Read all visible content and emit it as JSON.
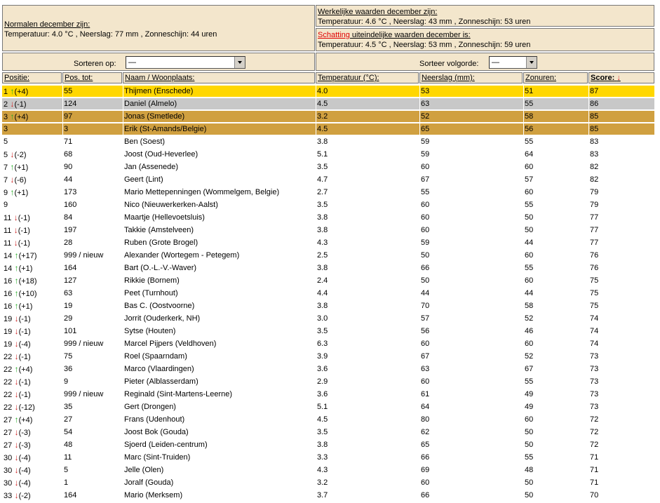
{
  "normals": {
    "heading": "Normalen december zijn:",
    "text": "Temperatuur: 4.0 °C , Neerslag: 77 mm , Zonneschijn: 44 uren"
  },
  "actual": {
    "heading": "Werkelijke waarden december zijn:",
    "text": "Temperatuur: 4.6 °C , Neerslag: 43 mm , Zonneschijn: 53 uren"
  },
  "estimate": {
    "heading_red": "Schatting",
    "heading_rest": " uiteindelijke waarden december is:",
    "text": "Temperatuur: 4.5 °C , Neerslag: 53 mm , Zonneschijn: 59 uren"
  },
  "sort": {
    "label": "Sorteren op:",
    "value": "—",
    "order_label": "Sorteer volgorde:",
    "order_value": "—"
  },
  "columns": {
    "pos": "Positie:",
    "postot": "Pos. tot:",
    "name": "Naam / Woonplaats:",
    "temp": "Temperatuur (°C):",
    "rain": "Neerslag (mm):",
    "sun": "Zonuren:",
    "score": "Score:"
  },
  "colors": {
    "gold": "#ffd700",
    "silver": "#c8c8c8",
    "bronze": "#d0a040",
    "header_bg": "#f3e6cc",
    "up_arrow": "#22aa22",
    "down_arrow": "#cc2222"
  },
  "rows": [
    {
      "pos": "1",
      "dir": "up",
      "chg": "(+4)",
      "tot": "55",
      "name": "Thijmen (Enschede)",
      "temp": "4.0",
      "rain": "53",
      "sun": "51",
      "score": "87",
      "hl": "gold"
    },
    {
      "pos": "2",
      "dir": "down",
      "chg": "(-1)",
      "tot": "124",
      "name": "Daniel (Almelo)",
      "temp": "4.5",
      "rain": "63",
      "sun": "55",
      "score": "86",
      "hl": "silver"
    },
    {
      "pos": "3",
      "dir": "up",
      "chg": "(+4)",
      "tot": "97",
      "name": "Jonas (Smetlede)",
      "temp": "3.2",
      "rain": "52",
      "sun": "58",
      "score": "85",
      "hl": "bronze"
    },
    {
      "pos": "3",
      "dir": "",
      "chg": "",
      "tot": "3",
      "name": "Erik (St-Amands/Belgie)",
      "temp": "4.5",
      "rain": "65",
      "sun": "56",
      "score": "85",
      "hl": "bronze"
    },
    {
      "pos": "5",
      "dir": "",
      "chg": "",
      "tot": "71",
      "name": "Ben (Soest)",
      "temp": "3.8",
      "rain": "59",
      "sun": "55",
      "score": "83",
      "hl": ""
    },
    {
      "pos": "5",
      "dir": "down",
      "chg": "(-2)",
      "tot": "68",
      "name": "Joost (Oud-Heverlee)",
      "temp": "5.1",
      "rain": "59",
      "sun": "64",
      "score": "83",
      "hl": ""
    },
    {
      "pos": "7",
      "dir": "up",
      "chg": "(+1)",
      "tot": "90",
      "name": "Jan (Assenede)",
      "temp": "3.5",
      "rain": "60",
      "sun": "60",
      "score": "82",
      "hl": ""
    },
    {
      "pos": "7",
      "dir": "down",
      "chg": "(-6)",
      "tot": "44",
      "name": "Geert (Lint)",
      "temp": "4.7",
      "rain": "67",
      "sun": "57",
      "score": "82",
      "hl": ""
    },
    {
      "pos": "9",
      "dir": "up",
      "chg": "(+1)",
      "tot": "173",
      "name": "Mario Mettepenningen (Wommelgem, Belgie)",
      "temp": "2.7",
      "rain": "55",
      "sun": "60",
      "score": "79",
      "hl": ""
    },
    {
      "pos": "9",
      "dir": "",
      "chg": "",
      "tot": "160",
      "name": "Nico (Nieuwerkerken-Aalst)",
      "temp": "3.5",
      "rain": "60",
      "sun": "55",
      "score": "79",
      "hl": ""
    },
    {
      "pos": "11",
      "dir": "down",
      "chg": "(-1)",
      "tot": "84",
      "name": "Maartje (Hellevoetsluis)",
      "temp": "3.8",
      "rain": "60",
      "sun": "50",
      "score": "77",
      "hl": ""
    },
    {
      "pos": "11",
      "dir": "down",
      "chg": "(-1)",
      "tot": "197",
      "name": "Takkie (Amstelveen)",
      "temp": "3.8",
      "rain": "60",
      "sun": "50",
      "score": "77",
      "hl": ""
    },
    {
      "pos": "11",
      "dir": "down",
      "chg": "(-1)",
      "tot": "28",
      "name": "Ruben (Grote Brogel)",
      "temp": "4.3",
      "rain": "59",
      "sun": "44",
      "score": "77",
      "hl": ""
    },
    {
      "pos": "14",
      "dir": "up",
      "chg": "(+17)",
      "tot": "999 / nieuw",
      "name": "Alexander (Wortegem - Petegem)",
      "temp": "2.5",
      "rain": "50",
      "sun": "60",
      "score": "76",
      "hl": ""
    },
    {
      "pos": "14",
      "dir": "up",
      "chg": "(+1)",
      "tot": "164",
      "name": "Bart (O.-L.-V.-Waver)",
      "temp": "3.8",
      "rain": "66",
      "sun": "55",
      "score": "76",
      "hl": ""
    },
    {
      "pos": "16",
      "dir": "up",
      "chg": "(+18)",
      "tot": "127",
      "name": "Rikkie (Bornem)",
      "temp": "2.4",
      "rain": "50",
      "sun": "60",
      "score": "75",
      "hl": ""
    },
    {
      "pos": "16",
      "dir": "up",
      "chg": "(+10)",
      "tot": "63",
      "name": "Peet (Turnhout)",
      "temp": "4.4",
      "rain": "44",
      "sun": "44",
      "score": "75",
      "hl": ""
    },
    {
      "pos": "16",
      "dir": "up",
      "chg": "(+1)",
      "tot": "19",
      "name": "Bas C. (Oostvoorne)",
      "temp": "3.8",
      "rain": "70",
      "sun": "58",
      "score": "75",
      "hl": ""
    },
    {
      "pos": "19",
      "dir": "down",
      "chg": "(-1)",
      "tot": "29",
      "name": "Jorrit (Ouderkerk, NH)",
      "temp": "3.0",
      "rain": "57",
      "sun": "52",
      "score": "74",
      "hl": ""
    },
    {
      "pos": "19",
      "dir": "down",
      "chg": "(-1)",
      "tot": "101",
      "name": "Sytse (Houten)",
      "temp": "3.5",
      "rain": "56",
      "sun": "46",
      "score": "74",
      "hl": ""
    },
    {
      "pos": "19",
      "dir": "down",
      "chg": "(-4)",
      "tot": "999 / nieuw",
      "name": "Marcel Pijpers (Veldhoven)",
      "temp": "6.3",
      "rain": "60",
      "sun": "60",
      "score": "74",
      "hl": ""
    },
    {
      "pos": "22",
      "dir": "down",
      "chg": "(-1)",
      "tot": "75",
      "name": "Roel (Spaarndam)",
      "temp": "3.9",
      "rain": "67",
      "sun": "52",
      "score": "73",
      "hl": ""
    },
    {
      "pos": "22",
      "dir": "up",
      "chg": "(+4)",
      "tot": "36",
      "name": "Marco (Vlaardingen)",
      "temp": "3.6",
      "rain": "63",
      "sun": "67",
      "score": "73",
      "hl": ""
    },
    {
      "pos": "22",
      "dir": "down",
      "chg": "(-1)",
      "tot": "9",
      "name": "Pieter (Alblasserdam)",
      "temp": "2.9",
      "rain": "60",
      "sun": "55",
      "score": "73",
      "hl": ""
    },
    {
      "pos": "22",
      "dir": "down",
      "chg": "(-1)",
      "tot": "999 / nieuw",
      "name": "Reginald (Sint-Martens-Leerne)",
      "temp": "3.6",
      "rain": "61",
      "sun": "49",
      "score": "73",
      "hl": ""
    },
    {
      "pos": "22",
      "dir": "down",
      "chg": "(-12)",
      "tot": "35",
      "name": "Gert (Drongen)",
      "temp": "5.1",
      "rain": "64",
      "sun": "49",
      "score": "73",
      "hl": ""
    },
    {
      "pos": "27",
      "dir": "up",
      "chg": "(+4)",
      "tot": "27",
      "name": "Frans (Udenhout)",
      "temp": "4.5",
      "rain": "80",
      "sun": "60",
      "score": "72",
      "hl": ""
    },
    {
      "pos": "27",
      "dir": "down",
      "chg": "(-3)",
      "tot": "54",
      "name": "Joost Bok (Gouda)",
      "temp": "3.5",
      "rain": "62",
      "sun": "50",
      "score": "72",
      "hl": ""
    },
    {
      "pos": "27",
      "dir": "down",
      "chg": "(-3)",
      "tot": "48",
      "name": "Sjoerd (Leiden-centrum)",
      "temp": "3.8",
      "rain": "65",
      "sun": "50",
      "score": "72",
      "hl": ""
    },
    {
      "pos": "30",
      "dir": "down",
      "chg": "(-4)",
      "tot": "11",
      "name": "Marc (Sint-Truiden)",
      "temp": "3.3",
      "rain": "66",
      "sun": "55",
      "score": "71",
      "hl": ""
    },
    {
      "pos": "30",
      "dir": "down",
      "chg": "(-4)",
      "tot": "5",
      "name": "Jelle (Olen)",
      "temp": "4.3",
      "rain": "69",
      "sun": "48",
      "score": "71",
      "hl": ""
    },
    {
      "pos": "30",
      "dir": "down",
      "chg": "(-4)",
      "tot": "1",
      "name": "Joralf (Gouda)",
      "temp": "3.2",
      "rain": "60",
      "sun": "50",
      "score": "71",
      "hl": ""
    },
    {
      "pos": "33",
      "dir": "down",
      "chg": "(-2)",
      "tot": "164",
      "name": "Mario (Merksem)",
      "temp": "3.7",
      "rain": "66",
      "sun": "50",
      "score": "70",
      "hl": ""
    }
  ]
}
